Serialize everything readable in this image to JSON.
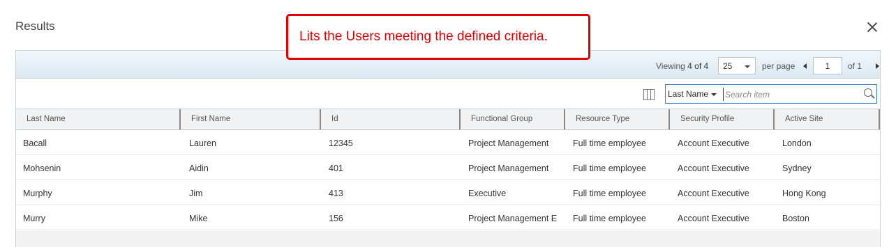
{
  "dialog": {
    "title": "Results"
  },
  "callout": {
    "text": "Lits the Users meeting the defined criteria."
  },
  "pager": {
    "viewing_label": "Viewing",
    "viewing_count": "4 of 4",
    "per_page_value": "25",
    "per_page_label": "per page",
    "current_page": "1",
    "of_pages": "of 1"
  },
  "search": {
    "field": "Last Name",
    "placeholder": "Search item"
  },
  "table": {
    "columns": [
      "Last Name",
      "First Name",
      "Id",
      "Functional Group",
      "Resource Type",
      "Security Profile",
      "Active Site"
    ],
    "rows": [
      [
        "Bacall",
        "Lauren",
        "12345",
        "Project Management",
        "Full time employee",
        "Account Executive",
        "London"
      ],
      [
        "Mohsenin",
        "Aidin",
        "401",
        "Project Management",
        "Full time employee",
        "Account Executive",
        "Sydney"
      ],
      [
        "Murphy",
        "Jim",
        "413",
        "Executive",
        "Full time employee",
        "Account Executive",
        "Hong Kong"
      ],
      [
        "Murry",
        "Mike",
        "156",
        "Project Management E",
        "Full time employee",
        "Account Executive",
        "Boston"
      ]
    ]
  },
  "colors": {
    "callout": "#e00000",
    "pager_bar": "#dce9f2",
    "search_border": "#3a7ec1"
  },
  "icons": [
    "close-icon",
    "columns-icon",
    "search-icon",
    "chevron-left-icon",
    "chevron-right-icon",
    "chevron-down-icon"
  ]
}
